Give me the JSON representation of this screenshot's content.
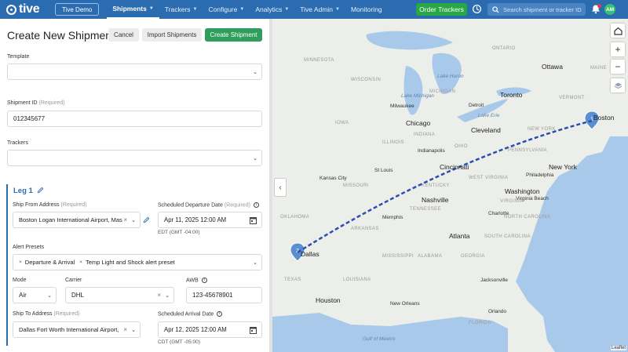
{
  "nav": {
    "logo_text": "tive",
    "account_button": "Tive Demo",
    "items": [
      {
        "label": "Shipments",
        "caret": true,
        "active": true
      },
      {
        "label": "Trackers",
        "caret": true,
        "active": false
      },
      {
        "label": "Configure",
        "caret": true,
        "active": false
      },
      {
        "label": "Analytics",
        "caret": true,
        "active": false
      },
      {
        "label": "Tive Admin",
        "caret": true,
        "active": false
      },
      {
        "label": "Monitoring",
        "caret": false,
        "active": false
      }
    ],
    "order_button": "Order Trackers",
    "search_placeholder": "Search shipment or tracker ID",
    "avatar_initials": "AM",
    "brand_color": "#2b6cb0"
  },
  "form": {
    "title": "Create New Shipment",
    "cancel_label": "Cancel",
    "import_label": "Import Shipments",
    "create_label": "Create Shipment",
    "template_label": "Template",
    "template_value": "",
    "shipment_id_label": "Shipment ID",
    "required_text": "(Required)",
    "shipment_id_value": "012345677",
    "trackers_label": "Trackers",
    "trackers_value": "",
    "leg": {
      "title": "Leg 1",
      "ship_from_label": "Ship From Address",
      "ship_from_value": "Boston Logan International Airport, Mas",
      "departure_label": "Scheduled Departure Date",
      "departure_value": "Apr 11, 2025 12:00 AM",
      "departure_tz": "EDT (GMT -04:00)",
      "alert_presets_label": "Alert Presets",
      "alert_presets": [
        "Departure & Arrival",
        "Temp Light and Shock alert preset"
      ],
      "mode_label": "Mode",
      "mode_value": "Air",
      "carrier_label": "Carrier",
      "carrier_value": "DHL",
      "awb_label": "AWB",
      "awb_value": "123-45678901",
      "ship_to_label": "Ship To Address",
      "ship_to_value": "Dallas Fort Worth International Airport,",
      "arrival_label": "Scheduled Arrival Date",
      "arrival_value": "Apr 12, 2025 12:00 AM",
      "arrival_tz": "CDT (GMT -05:00)"
    }
  },
  "map": {
    "route_color": "#2a4fb0",
    "marker_1": "1",
    "marker_2": "2",
    "attribution": "Leaflet",
    "labels": {
      "ottawa": "Ottawa",
      "toronto": "Toronto",
      "chicago": "Chicago",
      "detroit": "Detroit",
      "cleveland": "Cleveland",
      "boston": "Boston",
      "new_york": "New York",
      "philadelphia": "Philadelphia",
      "washington": "Washington",
      "cincinnati": "Cincinnati",
      "st_louis": "St Louis",
      "nashville": "Nashville",
      "dallas": "Dallas",
      "houston": "Houston",
      "atlanta": "Atlanta",
      "memphis": "Memphis",
      "charlotte": "Charlotte",
      "virginia_beach": "Virginia Beach",
      "milwaukee": "Milwaukee",
      "indianapolis": "Indianapolis",
      "kansas_city": "Kansas City",
      "new_orleans": "New Orleans",
      "jacksonville": "Jacksonville",
      "orlando": "Orlando",
      "lake_michigan": "Lake Michigan",
      "lake_huron": "Lake Huron",
      "lake_erie": "Lake Erie",
      "minnesota": "MINNESOTA",
      "wisconsin": "WISCONSIN",
      "michigan": "MICHIGAN",
      "iowa": "IOWA",
      "illinois": "ILLINOIS",
      "indiana": "INDIANA",
      "ohio": "OHIO",
      "missouri": "MISSOURI",
      "kentucky": "KENTUCKY",
      "tennessee": "TENNESSEE",
      "arkansas": "ARKANSAS",
      "oklahoma": "OKLAHOMA",
      "texas": "TEXAS",
      "louisiana": "LOUISIANA",
      "mississippi": "MISSISSIPPI",
      "alabama": "ALABAMA",
      "georgia": "GEORGIA",
      "south_carolina": "SOUTH CAROLINA",
      "north_carolina": "NORTH CAROLINA",
      "virginia": "VIRGINIA",
      "west_virginia": "WEST VIRGINIA",
      "pennsylvania": "PENNSYLVANIA",
      "new_york_state": "NEW YORK",
      "vermont": "VERMONT",
      "maine": "MAINE",
      "florida": "FLORIDA",
      "gulf": "Gulf of Mexico",
      "ontario": "ONTARIO"
    }
  }
}
